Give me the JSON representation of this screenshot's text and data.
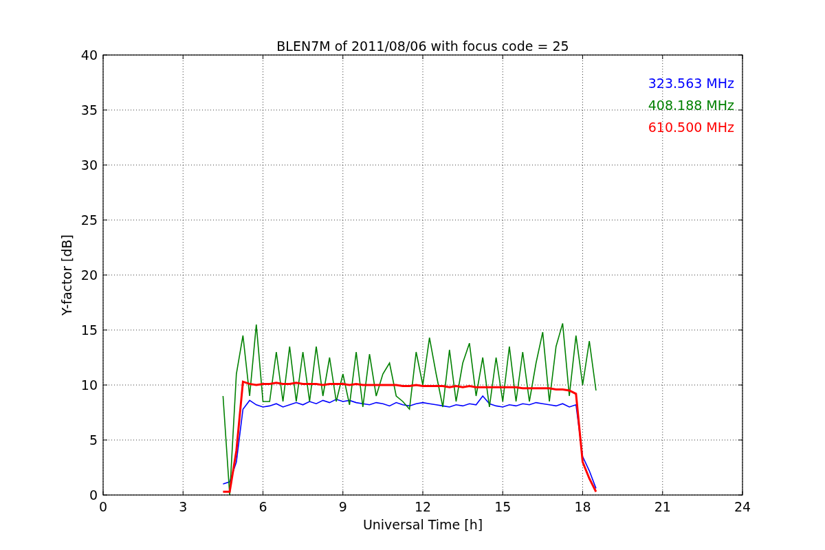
{
  "chart_data": {
    "type": "line",
    "title": "BLEN7M of 2011/08/06 with focus code = 25",
    "xlabel": "Universal Time [h]",
    "ylabel": "Y-factor [dB]",
    "x": [
      4.5,
      4.75,
      5.0,
      5.25,
      5.5,
      5.75,
      6.0,
      6.25,
      6.5,
      6.75,
      7.0,
      7.25,
      7.5,
      7.75,
      8.0,
      8.25,
      8.5,
      8.75,
      9.0,
      9.25,
      9.5,
      9.75,
      10.0,
      10.25,
      10.5,
      10.75,
      11.0,
      11.25,
      11.5,
      11.75,
      12.0,
      12.25,
      12.5,
      12.75,
      13.0,
      13.25,
      13.5,
      13.75,
      14.0,
      14.25,
      14.5,
      14.75,
      15.0,
      15.25,
      15.5,
      15.75,
      16.0,
      16.25,
      16.5,
      16.75,
      17.0,
      17.25,
      17.5,
      17.75,
      18.0,
      18.25,
      18.5
    ],
    "series": [
      {
        "name": "323.563 MHz",
        "color": "#0000ff",
        "values": [
          1.0,
          1.2,
          3.0,
          7.8,
          8.6,
          8.2,
          8.0,
          8.1,
          8.3,
          8.0,
          8.2,
          8.4,
          8.2,
          8.5,
          8.3,
          8.6,
          8.4,
          8.7,
          8.5,
          8.6,
          8.4,
          8.3,
          8.2,
          8.4,
          8.3,
          8.1,
          8.4,
          8.2,
          8.1,
          8.3,
          8.4,
          8.3,
          8.2,
          8.1,
          8.0,
          8.2,
          8.1,
          8.3,
          8.2,
          9.0,
          8.3,
          8.1,
          8.0,
          8.2,
          8.1,
          8.3,
          8.2,
          8.4,
          8.3,
          8.2,
          8.1,
          8.3,
          8.0,
          8.2,
          3.5,
          2.2,
          0.6
        ]
      },
      {
        "name": "408.188 MHz",
        "color": "#008000",
        "values": [
          9.0,
          0.0,
          11.0,
          14.5,
          9.0,
          15.5,
          8.5,
          8.5,
          13.0,
          8.5,
          13.5,
          8.5,
          13.0,
          8.5,
          13.5,
          9.0,
          12.5,
          8.5,
          11.0,
          8.2,
          13.0,
          8.0,
          12.8,
          9.0,
          11.0,
          12.0,
          9.0,
          8.5,
          7.8,
          13.0,
          10.0,
          14.3,
          11.0,
          8.0,
          13.2,
          8.5,
          12.0,
          13.8,
          9.0,
          12.5,
          8.0,
          12.5,
          8.5,
          13.5,
          8.5,
          13.0,
          8.5,
          12.0,
          14.8,
          8.5,
          13.5,
          15.6,
          9.0,
          14.5,
          10.0,
          14.0,
          9.5
        ]
      },
      {
        "name": "610.500 MHz",
        "color": "#ff0000",
        "values": [
          0.3,
          0.3,
          4.0,
          10.3,
          10.1,
          10.0,
          10.1,
          10.1,
          10.2,
          10.1,
          10.1,
          10.2,
          10.1,
          10.1,
          10.1,
          10.0,
          10.1,
          10.1,
          10.1,
          10.0,
          10.1,
          10.0,
          10.0,
          10.0,
          10.0,
          10.0,
          10.0,
          9.9,
          9.9,
          10.0,
          9.9,
          9.9,
          9.9,
          9.9,
          9.8,
          9.9,
          9.8,
          9.9,
          9.8,
          9.8,
          9.8,
          9.8,
          9.8,
          9.8,
          9.8,
          9.7,
          9.7,
          9.7,
          9.7,
          9.7,
          9.6,
          9.6,
          9.5,
          9.2,
          3.0,
          1.5,
          0.3
        ]
      }
    ],
    "grid": true,
    "xlim": [
      0,
      24
    ],
    "ylim": [
      0,
      40
    ],
    "xticks": [
      0,
      3,
      6,
      9,
      12,
      15,
      18,
      21,
      24
    ],
    "yticks": [
      0,
      5,
      10,
      15,
      20,
      25,
      30,
      35,
      40
    ]
  }
}
